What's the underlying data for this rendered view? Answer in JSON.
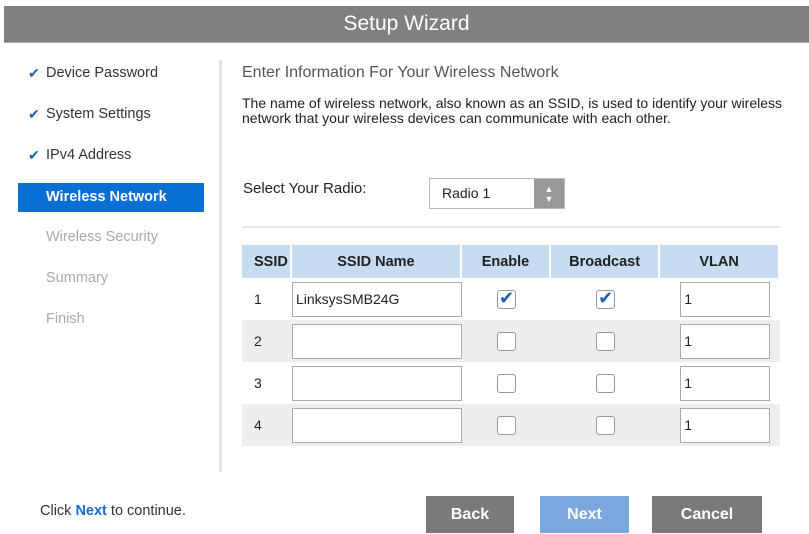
{
  "title": "Setup Wizard",
  "sidebar": {
    "items": [
      {
        "label": "Device Password",
        "state": "done"
      },
      {
        "label": "System Settings",
        "state": "done"
      },
      {
        "label": "IPv4 Address",
        "state": "done"
      },
      {
        "label": "Wireless Network",
        "state": "active"
      },
      {
        "label": "Wireless Security",
        "state": "todo"
      },
      {
        "label": "Summary",
        "state": "todo"
      },
      {
        "label": "Finish",
        "state": "todo"
      }
    ]
  },
  "main": {
    "heading": "Enter Information For Your Wireless Network",
    "description": "The name of wireless network, also known as an SSID, is used to identify your wireless network that your wireless devices can communicate with each other.",
    "radio_label": "Select Your Radio:",
    "radio_value": "Radio 1",
    "columns": [
      "SSID",
      "SSID Name",
      "Enable",
      "Broadcast",
      "VLAN"
    ],
    "rows": [
      {
        "ssid": "1",
        "name": "LinksysSMB24G",
        "enable": true,
        "broadcast": true,
        "vlan": "1"
      },
      {
        "ssid": "2",
        "name": "",
        "enable": false,
        "broadcast": false,
        "vlan": "1"
      },
      {
        "ssid": "3",
        "name": "",
        "enable": false,
        "broadcast": false,
        "vlan": "1"
      },
      {
        "ssid": "4",
        "name": "",
        "enable": false,
        "broadcast": false,
        "vlan": "1"
      }
    ]
  },
  "footer": {
    "pre": "Click ",
    "link": "Next",
    "post": " to continue."
  },
  "buttons": {
    "back": "Back",
    "next": "Next",
    "cancel": "Cancel"
  }
}
